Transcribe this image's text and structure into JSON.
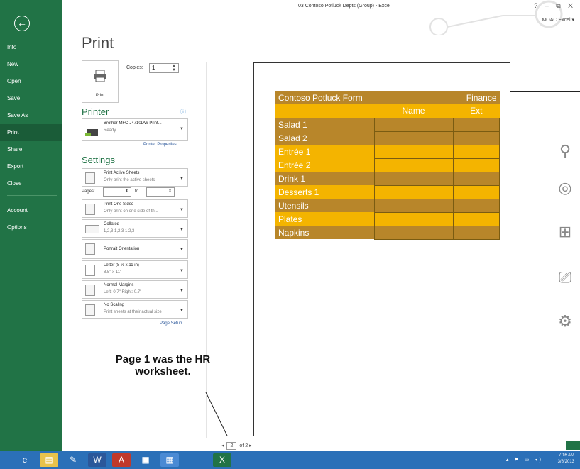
{
  "window": {
    "title": "03 Contoso Potluck Depts (Group) - Excel",
    "controls": "? – ⧉ ✕",
    "account": "MOAC Excel ▾"
  },
  "nav": {
    "back_icon": "back-arrow-icon",
    "items": [
      "Info",
      "New",
      "Open",
      "Save",
      "Save As",
      "Print",
      "Share",
      "Export",
      "Close",
      "Account",
      "Options"
    ],
    "active": "Print"
  },
  "print": {
    "heading": "Print",
    "button_label": "Print",
    "copies_label": "Copies:",
    "copies_value": "1"
  },
  "printer": {
    "section_label": "Printer",
    "name": "Brother MFC-J4710DW Print...",
    "status": "Ready",
    "properties_link": "Printer Properties"
  },
  "settings": {
    "section_label": "Settings",
    "active_sheets": {
      "title": "Print Active Sheets",
      "subtitle": "Only print the active sheets"
    },
    "pages_label": "Pages:",
    "pages_to": "to",
    "one_sided": {
      "title": "Print One Sided",
      "subtitle": "Only print on one side of th..."
    },
    "collated": {
      "title": "Collated",
      "subtitle": "1,2,3   1,2,3   1,2,3"
    },
    "orientation": {
      "title": "Portrait Orientation"
    },
    "paper": {
      "title": "Letter (8 ½ x 11 in)",
      "subtitle": "8.5\" x 11\""
    },
    "margins": {
      "title": "Normal Margins",
      "subtitle": "Left: 0.7\"   Right: 0.7\""
    },
    "scaling": {
      "title": "No Scaling",
      "subtitle": "Print sheets at their actual size"
    },
    "page_setup_link": "Page Setup"
  },
  "preview": {
    "form_title": "Contoso Potluck Form",
    "department": "Finance",
    "col_name": "Name",
    "col_ext": "Ext",
    "rows": [
      "Salad 1",
      "Salad 2",
      "Entrée 1",
      "Entrée 2",
      "Drink 1",
      "Desserts 1",
      "Utensils",
      "Plates",
      "Napkins"
    ]
  },
  "pager": {
    "current": "2",
    "total": "of 2"
  },
  "annotation": "Page 1 was the HR worksheet.",
  "taskbar": {
    "time": "7:16 AM",
    "date": "3/8/2013"
  },
  "colors": {
    "excel_green": "#217346",
    "gold_dark": "#b8862a",
    "gold_light": "#f4b400",
    "taskbar_blue": "#2b70b8"
  }
}
